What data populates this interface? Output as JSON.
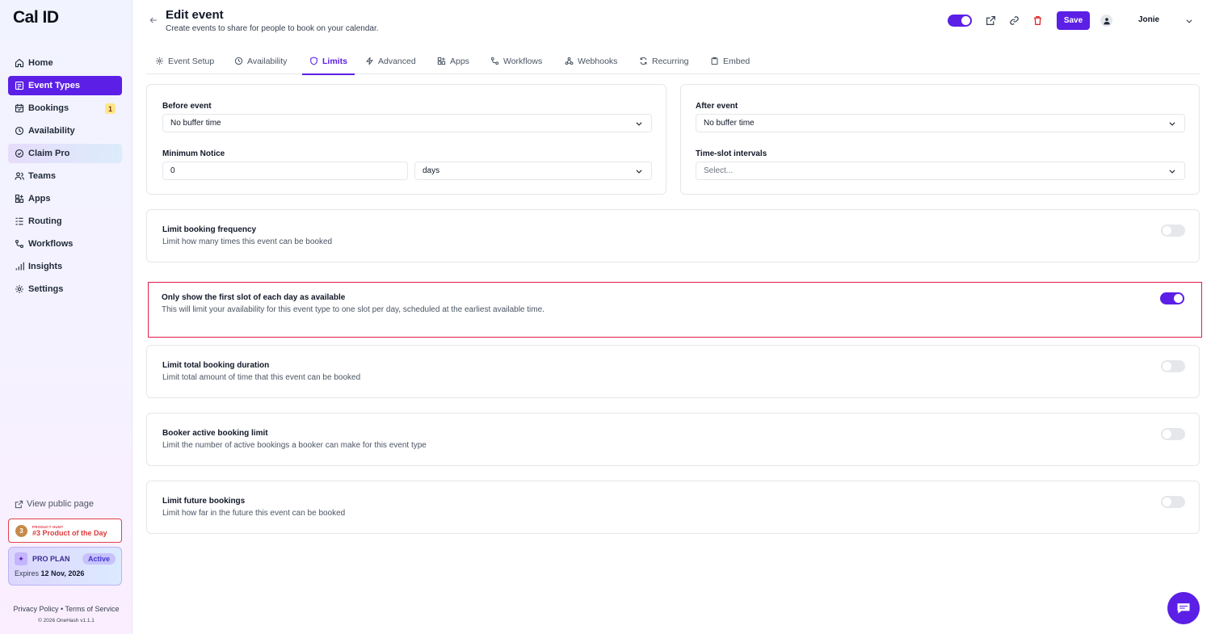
{
  "app": {
    "logo": "Cal ID"
  },
  "sidebar": {
    "items": [
      {
        "label": "Home",
        "icon": "home-icon"
      },
      {
        "label": "Event Types",
        "icon": "event-types-icon",
        "active": true
      },
      {
        "label": "Bookings",
        "icon": "calendar-check-icon",
        "badge": "1"
      },
      {
        "label": "Availability",
        "icon": "clock-icon"
      },
      {
        "label": "Claim Pro",
        "icon": "badge-icon"
      },
      {
        "label": "Teams",
        "icon": "users-icon"
      },
      {
        "label": "Apps",
        "icon": "apps-grid-icon"
      },
      {
        "label": "Routing",
        "icon": "routing-icon"
      },
      {
        "label": "Workflows",
        "icon": "workflow-icon"
      },
      {
        "label": "Insights",
        "icon": "bar-chart-icon"
      },
      {
        "label": "Settings",
        "icon": "gear-icon"
      }
    ],
    "view_public": "View public page",
    "product_hunt": {
      "small": "PRODUCT HUNT",
      "main": "#3 Product of the Day"
    },
    "plan": {
      "name": "PRO PLAN",
      "status": "Active",
      "expires_label": "Expires",
      "expires_date": "12 Nov, 2026"
    },
    "footer_links": "Privacy Policy • Terms of Service",
    "copyright": "© 2026 OneHash v1.1.1"
  },
  "header": {
    "title": "Edit event",
    "subtitle": "Create events to share for people to book on your calendar.",
    "save_label": "Save",
    "user_name": "Jonie"
  },
  "tabs": [
    {
      "label": "Event Setup",
      "icon": "gear-icon"
    },
    {
      "label": "Availability",
      "icon": "clock-icon"
    },
    {
      "label": "Limits",
      "icon": "shield-icon",
      "active": true
    },
    {
      "label": "Advanced",
      "icon": "lightning-icon"
    },
    {
      "label": "Apps",
      "icon": "apps-grid-icon"
    },
    {
      "label": "Workflows",
      "icon": "workflow-icon"
    },
    {
      "label": "Webhooks",
      "icon": "webhook-icon"
    },
    {
      "label": "Recurring",
      "icon": "repeat-icon"
    },
    {
      "label": "Embed",
      "icon": "clipboard-icon"
    }
  ],
  "buffers": {
    "before_label": "Before event",
    "before_value": "No buffer time",
    "after_label": "After event",
    "after_value": "No buffer time",
    "notice_label": "Minimum Notice",
    "notice_value": "0",
    "notice_unit": "days",
    "interval_label": "Time-slot intervals",
    "interval_placeholder": "Select..."
  },
  "settings": [
    {
      "title": "Limit booking frequency",
      "desc": "Limit how many times this event can be booked",
      "enabled": false
    },
    {
      "title": "Only show the first slot of each day as available",
      "desc": "This will limit your availability for this event type to one slot per day, scheduled at the earliest available time.",
      "enabled": true
    },
    {
      "title": "Limit total booking duration",
      "desc": "Limit total amount of time that this event can be booked",
      "enabled": false
    },
    {
      "title": "Booker active booking limit",
      "desc": "Limit the number of active bookings a booker can make for this event type",
      "enabled": false
    },
    {
      "title": "Limit future bookings",
      "desc": "Limit how far in the future this event can be booked",
      "enabled": false
    }
  ],
  "colors": {
    "accent": "#5b1fe6",
    "highlight": "#e11d48",
    "badge": "#fde68a"
  }
}
